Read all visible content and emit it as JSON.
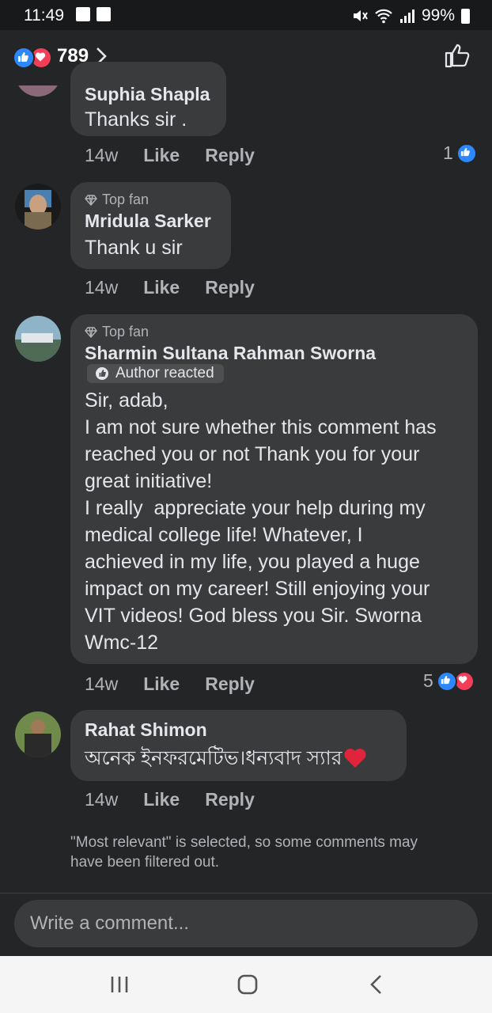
{
  "status_bar": {
    "time": "11:49",
    "battery": "99%"
  },
  "header": {
    "reaction_count": "789"
  },
  "comments": [
    {
      "author": "Suphia Shapla",
      "text": "Thanks sir .",
      "time": "14w",
      "like": "Like",
      "reply": "Reply",
      "reaction_count": "1"
    },
    {
      "badge": "Top fan",
      "author": "Mridula Sarker",
      "text": "Thank u sir",
      "time": "14w",
      "like": "Like",
      "reply": "Reply"
    },
    {
      "badge": "Top fan",
      "author": "Sharmin Sultana Rahman Sworna",
      "author_reacted": "Author reacted",
      "lines": [
        "Sir, adab,",
        "I am not sure whether this comment has",
        "reached you or not Thank you for your",
        "great initiative!",
        "I really  appreciate your help during my",
        "medical college life! Whatever, I",
        "achieved in my life, you played a huge",
        "impact on my career! Still enjoying your",
        "VIT videos! God bless you Sir. Sworna",
        "Wmc-12"
      ],
      "time": "14w",
      "like": "Like",
      "reply": "Reply",
      "reaction_count": "5"
    },
    {
      "author": "Rahat Shimon",
      "text": "অনেক ইনফরমেটিভ।ধন্যবাদ স্যার",
      "time": "14w",
      "like": "Like",
      "reply": "Reply"
    }
  ],
  "notice": "\"Most relevant\" is selected, so some comments may have been filtered out.",
  "composer": {
    "placeholder": "Write a comment..."
  },
  "colors": {
    "background": "#242526",
    "bubble": "#3a3b3c",
    "like_blue": "#2d88ff",
    "love_red": "#f33e58"
  }
}
